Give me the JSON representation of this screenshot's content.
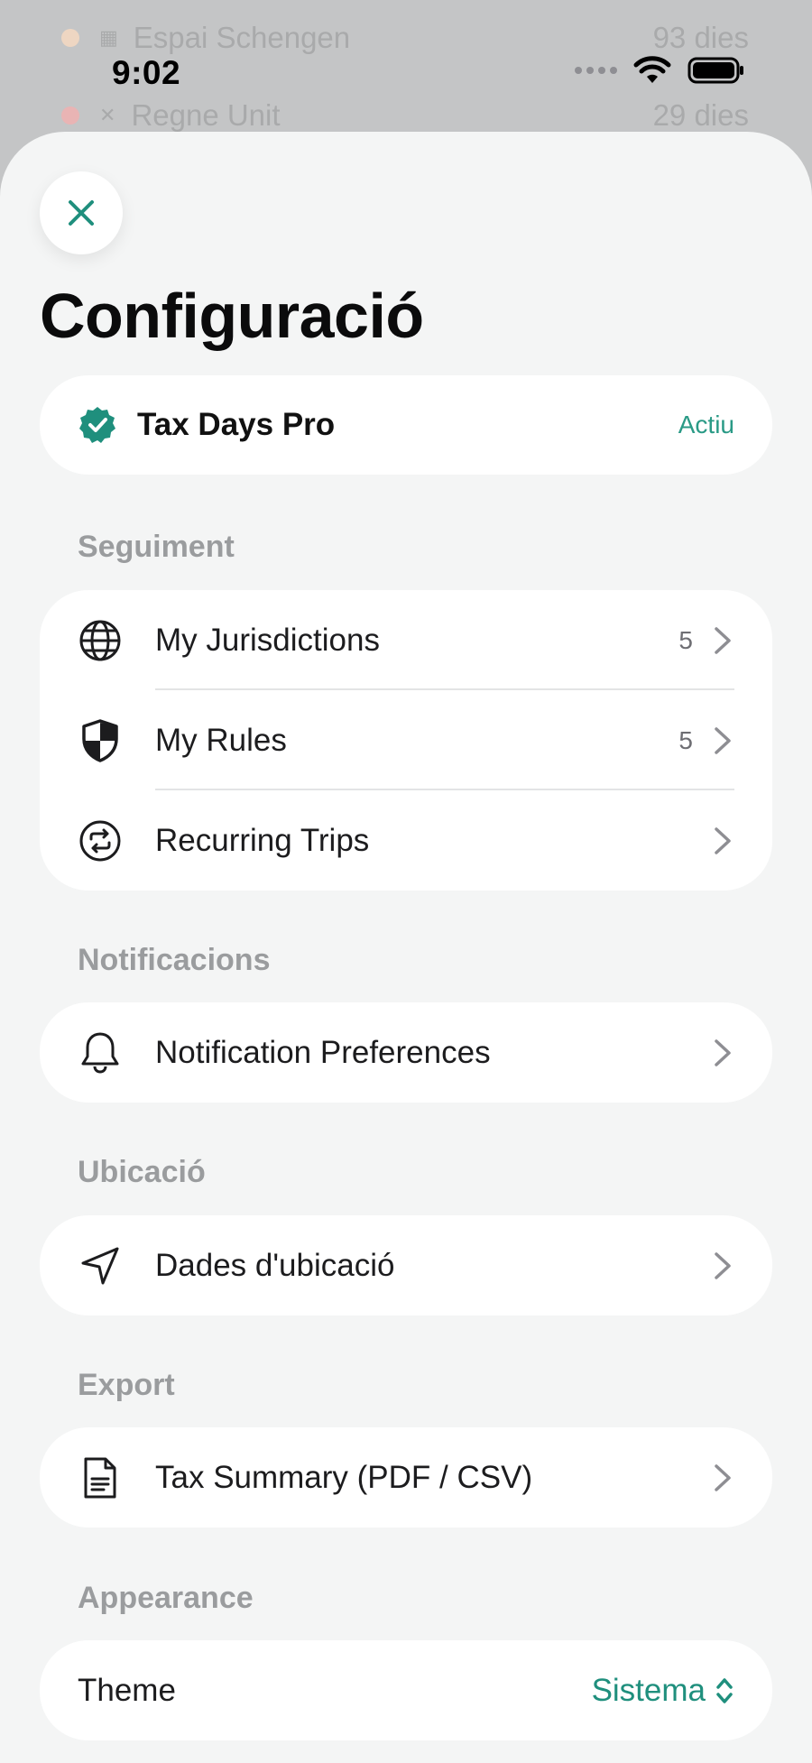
{
  "background": {
    "rows": [
      {
        "name": "Espai Schengen",
        "days": "93 dies",
        "dot_color": "#e8c7a8"
      },
      {
        "name": "Regne Unit",
        "days": "29 dies",
        "dot_color": "#e6a3a3"
      }
    ]
  },
  "status_bar": {
    "time": "9:02"
  },
  "sheet": {
    "title": "Configuració",
    "close_icon": "close-icon",
    "pro": {
      "name": "Tax Days Pro",
      "status": "Actiu",
      "icon": "verified-badge-icon"
    },
    "sections": {
      "tracking": {
        "label": "Seguiment",
        "items": [
          {
            "label": "My Jurisdictions",
            "count": "5",
            "icon": "globe-icon"
          },
          {
            "label": "My Rules",
            "count": "5",
            "icon": "shield-icon"
          },
          {
            "label": "Recurring Trips",
            "count": "",
            "icon": "repeat-icon"
          }
        ]
      },
      "notifications": {
        "label": "Notificacions",
        "items": [
          {
            "label": "Notification Preferences",
            "icon": "bell-icon"
          }
        ]
      },
      "location": {
        "label": "Ubicació",
        "items": [
          {
            "label": "Dades d'ubicació",
            "icon": "location-arrow-icon"
          }
        ]
      },
      "export": {
        "label": "Export",
        "items": [
          {
            "label": "Tax Summary (PDF / CSV)",
            "icon": "document-icon"
          }
        ]
      },
      "appearance": {
        "label": "Appearance",
        "theme_label": "Theme",
        "theme_value": "Sistema"
      }
    }
  },
  "colors": {
    "accent": "#1f8f7d",
    "sheet_bg": "#f4f5f5",
    "card_bg": "#ffffff",
    "section_label": "#9a9c9e"
  }
}
